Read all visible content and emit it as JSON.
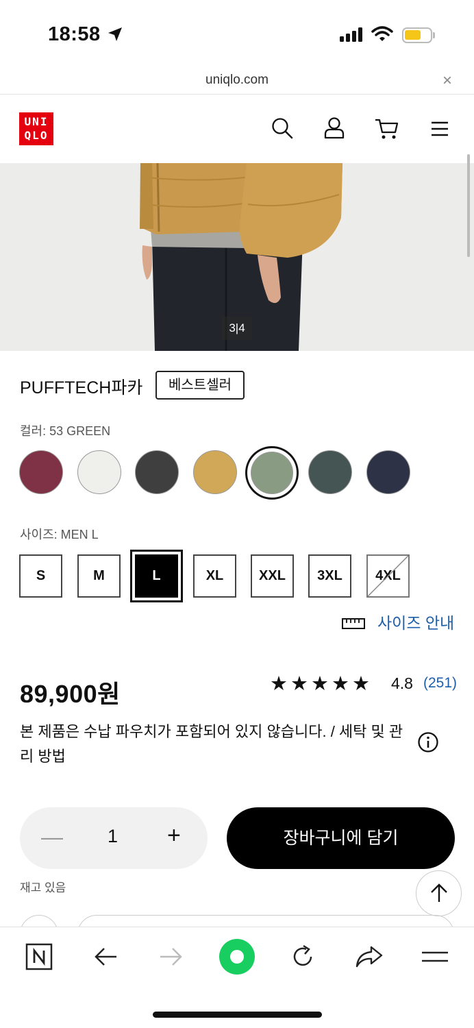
{
  "status_bar": {
    "time": "18:58"
  },
  "browser": {
    "url": "uniqlo.com",
    "close_label": "×"
  },
  "header": {
    "logo_line1": "UNI",
    "logo_line2": "QLO",
    "brand_color": "#e50010"
  },
  "gallery": {
    "counter": "3|4"
  },
  "product": {
    "name": "PUFFTECH파카",
    "badge": "베스트셀러",
    "color_label": "컬러: 53 GREEN",
    "colors": [
      {
        "name": "wine",
        "hex": "#7f3245"
      },
      {
        "name": "off-white",
        "hex": "#efefec"
      },
      {
        "name": "dark-gray",
        "hex": "#3f3f3f"
      },
      {
        "name": "mustard",
        "hex": "#d1a857"
      },
      {
        "name": "green",
        "hex": "#8a9b83",
        "selected": true
      },
      {
        "name": "dark-green",
        "hex": "#455553"
      },
      {
        "name": "navy",
        "hex": "#2d3246"
      }
    ],
    "size_label": "사이즈: MEN L",
    "sizes": [
      "S",
      "M",
      "L",
      "XL",
      "XXL",
      "3XL",
      "4XL"
    ],
    "selected_size": "L",
    "unavailable_size": "4XL",
    "size_guide": "사이즈 안내",
    "price": "89,900원",
    "rating": "4.8",
    "rating_count": "(251)",
    "notice": "본 제품은 수납 파우치가 포함되어 있지 않습니다. / 세탁 및 관리 방법",
    "quantity": "1",
    "add_to_cart": "장바구니에 담기",
    "stock_status": "재고 있음"
  }
}
